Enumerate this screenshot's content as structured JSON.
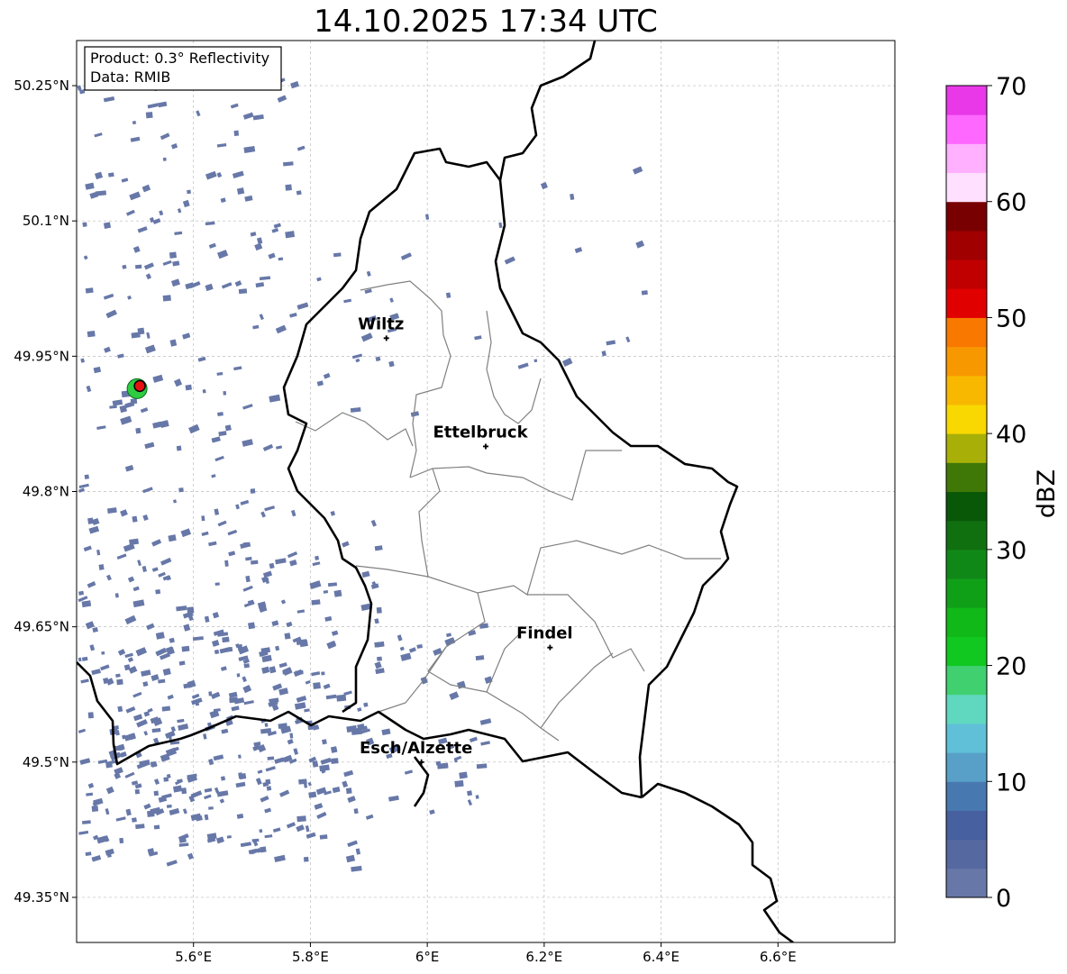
{
  "title": "14.10.2025 17:34 UTC",
  "info_box": {
    "product": "Product: 0.3° Reflectivity",
    "data": "Data: RMIB"
  },
  "map": {
    "lon_range": [
      5.4,
      6.8
    ],
    "lat_range": [
      49.3,
      50.3
    ],
    "lon_ticks": [
      {
        "value": 5.6,
        "label": "5.6°E"
      },
      {
        "value": 5.8,
        "label": "5.8°E"
      },
      {
        "value": 6.0,
        "label": "6°E"
      },
      {
        "value": 6.2,
        "label": "6.2°E"
      },
      {
        "value": 6.4,
        "label": "6.4°E"
      },
      {
        "value": 6.6,
        "label": "6.6°E"
      }
    ],
    "lat_ticks": [
      {
        "value": 49.35,
        "label": "49.35°N"
      },
      {
        "value": 49.5,
        "label": "49.5°N"
      },
      {
        "value": 49.65,
        "label": "49.65°N"
      },
      {
        "value": 49.8,
        "label": "49.8°N"
      },
      {
        "value": 49.95,
        "label": "49.95°N"
      },
      {
        "value": 50.1,
        "label": "50.1°N"
      },
      {
        "value": 50.25,
        "label": "50.25°N"
      }
    ],
    "cities": [
      {
        "name": "Wiltz",
        "lon": 5.93,
        "lat": 49.97
      },
      {
        "name": "Ettelbruck",
        "lon": 6.1,
        "lat": 49.85
      },
      {
        "name": "Findel",
        "lon": 6.21,
        "lat": 49.627
      },
      {
        "name": "Esch/Alzette",
        "lon": 5.99,
        "lat": 49.5
      }
    ],
    "radar_site": {
      "lon": 5.505,
      "lat": 49.915
    },
    "echo_color": "#6778a8",
    "border_color": "#000000",
    "canton_color": "#808080"
  },
  "colorbar": {
    "label": "dBZ",
    "min": 0,
    "max": 70,
    "step": 2.5,
    "tick_values": [
      0,
      10,
      20,
      30,
      40,
      50,
      60,
      70
    ],
    "colors": [
      "#6778a8",
      "#5668a0",
      "#4760a0",
      "#4878b0",
      "#58a0c8",
      "#60c0d8",
      "#60d8c0",
      "#40d070",
      "#10c820",
      "#10b818",
      "#10a018",
      "#108818",
      "#107010",
      "#085808",
      "#407808",
      "#a8b008",
      "#f8d800",
      "#f8b800",
      "#f89800",
      "#f87800",
      "#e00000",
      "#c00000",
      "#a00000",
      "#780000",
      "#ffe0ff",
      "#ffb0ff",
      "#ff68ff",
      "#e838e8"
    ]
  }
}
